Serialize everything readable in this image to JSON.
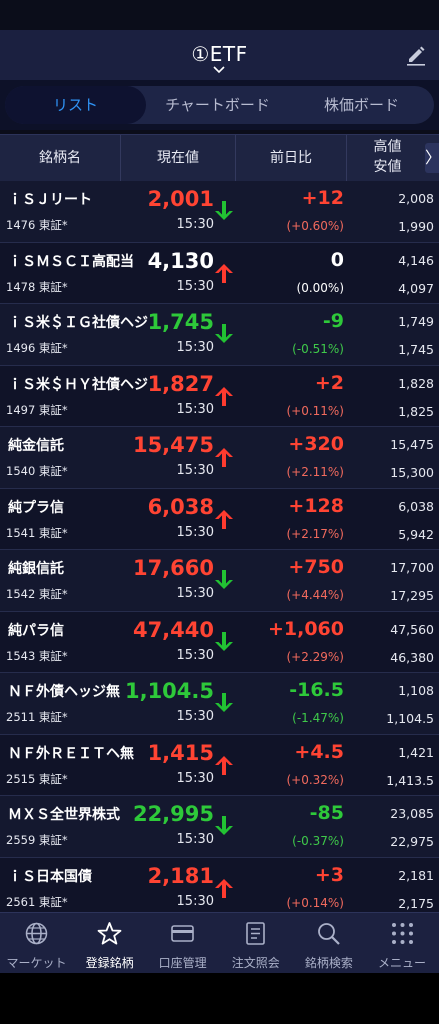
{
  "header": {
    "title": "①ETF"
  },
  "tabs": [
    {
      "label": "リスト",
      "active": true
    },
    {
      "label": "チャートボード",
      "active": false
    },
    {
      "label": "株価ボード",
      "active": false
    }
  ],
  "table_header": {
    "name": "銘柄名",
    "price": "現在値",
    "change": "前日比",
    "high": "高値",
    "low": "安値",
    "next": "〉"
  },
  "rows": [
    {
      "name": "ｉＳＪリート",
      "code": "1476 東証*",
      "price": "2,001",
      "time": "15:30",
      "dir": "down",
      "change": "+12",
      "pct": "(+0.60%)",
      "high": "2,008",
      "low": "1,990"
    },
    {
      "name": "ｉＳＭＳＣＩ高配当",
      "code": "1478 東証*",
      "price": "4,130",
      "time": "15:30",
      "dir": "up",
      "change": "0",
      "pct": "(0.00%)",
      "high": "4,146",
      "low": "4,097"
    },
    {
      "name": "ｉＳ米＄ＩＧ社債ヘジ",
      "code": "1496 東証*",
      "price": "1,745",
      "time": "15:30",
      "dir": "down",
      "change": "-9",
      "pct": "(-0.51%)",
      "high": "1,749",
      "low": "1,745"
    },
    {
      "name": "ｉＳ米＄ＨＹ社債ヘジ",
      "code": "1497 東証*",
      "price": "1,827",
      "time": "15:30",
      "dir": "up",
      "change": "+2",
      "pct": "(+0.11%)",
      "high": "1,828",
      "low": "1,825"
    },
    {
      "name": "純金信託",
      "code": "1540 東証*",
      "price": "15,475",
      "time": "15:30",
      "dir": "up",
      "change": "+320",
      "pct": "(+2.11%)",
      "high": "15,475",
      "low": "15,300"
    },
    {
      "name": "純プラ信",
      "code": "1541 東証*",
      "price": "6,038",
      "time": "15:30",
      "dir": "up",
      "change": "+128",
      "pct": "(+2.17%)",
      "high": "6,038",
      "low": "5,942"
    },
    {
      "name": "純銀信託",
      "code": "1542 東証*",
      "price": "17,660",
      "time": "15:30",
      "dir": "down",
      "change": "+750",
      "pct": "(+4.44%)",
      "high": "17,700",
      "low": "17,295"
    },
    {
      "name": "純パラ信",
      "code": "1543 東証*",
      "price": "47,440",
      "time": "15:30",
      "dir": "down",
      "change": "+1,060",
      "pct": "(+2.29%)",
      "high": "47,560",
      "low": "46,380"
    },
    {
      "name": "ＮＦ外債ヘッジ無",
      "code": "2511 東証*",
      "price": "1,104.5",
      "time": "15:30",
      "dir": "down",
      "change": "-16.5",
      "pct": "(-1.47%)",
      "high": "1,108",
      "low": "1,104.5"
    },
    {
      "name": "ＮＦ外ＲＥＩＴヘ無",
      "code": "2515 東証*",
      "price": "1,415",
      "time": "15:30",
      "dir": "up",
      "change": "+4.5",
      "pct": "(+0.32%)",
      "high": "1,421",
      "low": "1,413.5"
    },
    {
      "name": "ＭＸＳ全世界株式",
      "code": "2559 東証*",
      "price": "22,995",
      "time": "15:30",
      "dir": "down",
      "change": "-85",
      "pct": "(-0.37%)",
      "high": "23,085",
      "low": "22,975"
    },
    {
      "name": "ｉＳ日本国債",
      "code": "2561 東証*",
      "price": "2,181",
      "time": "15:30",
      "dir": "up",
      "change": "+3",
      "pct": "(+0.14%)",
      "high": "2,181",
      "low": "2,175"
    }
  ],
  "nav": [
    {
      "label": "マーケット",
      "icon": "globe-icon",
      "active": false
    },
    {
      "label": "登録銘柄",
      "icon": "star-icon",
      "active": true
    },
    {
      "label": "口座管理",
      "icon": "card-icon",
      "active": false
    },
    {
      "label": "注文照会",
      "icon": "document-icon",
      "active": false
    },
    {
      "label": "銘柄検索",
      "icon": "search-icon",
      "active": false
    },
    {
      "label": "メニュー",
      "icon": "grid-menu-icon",
      "active": false
    }
  ],
  "colors": {
    "up": "#ff4433",
    "down": "#2ec93a",
    "flat": "#ffffff",
    "arrow_up": "#ff3b2f",
    "arrow_down": "#22c233",
    "active_tab": "#2f93f5"
  }
}
